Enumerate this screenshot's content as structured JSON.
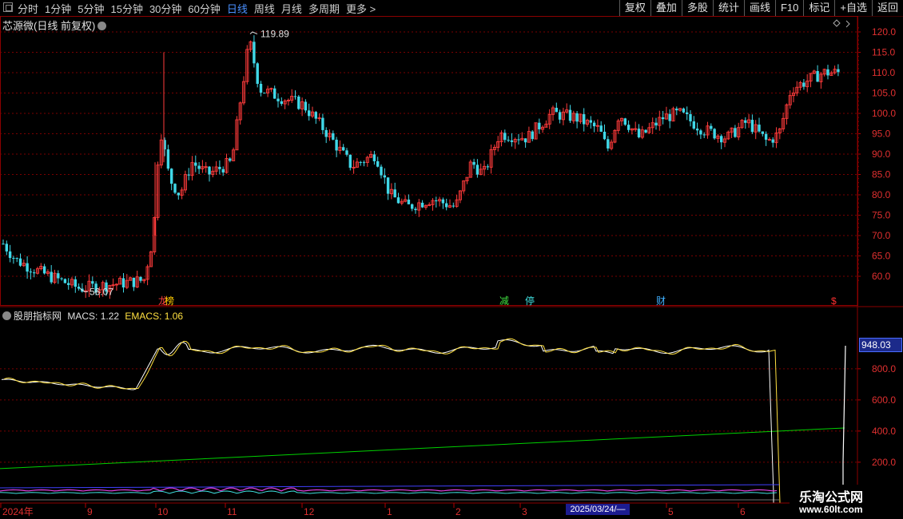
{
  "toolbar": {
    "periods": [
      "分时",
      "1分钟",
      "5分钟",
      "15分钟",
      "30分钟",
      "60分钟",
      "日线",
      "周线",
      "月线",
      "多周期",
      "更多 >"
    ],
    "active_period": "日线",
    "right_buttons": [
      "复权",
      "叠加",
      "多股",
      "统计",
      "画线",
      "F10",
      "标记",
      "+自选",
      "返回"
    ]
  },
  "main_chart": {
    "title": "芯源微(日线 前复权)",
    "price_axis": [
      "120.0",
      "115.0",
      "110.0",
      "105.0",
      "100.0",
      "95.0",
      "90.0",
      "85.0",
      "80.0",
      "75.0",
      "70.0",
      "65.0",
      "60.0"
    ],
    "high_annotation": "119.89",
    "low_annotation": "56.07",
    "event_markers": [
      {
        "text": "龙",
        "color": "#ff4040"
      },
      {
        "text": "榜",
        "color": "#ffcc00"
      },
      {
        "text": "减",
        "color": "#40e040"
      },
      {
        "text": "停",
        "color": "#40e0e0"
      },
      {
        "text": "财",
        "color": "#40b0ff"
      },
      {
        "text": "$",
        "color": "#ff3030"
      }
    ]
  },
  "indicator": {
    "title": "股朋指标网",
    "macs_label": "MACS: 1.22",
    "emacs_label": "EMACS: 1.06",
    "axis": [
      "800.0",
      "600.0",
      "400.0",
      "200.0"
    ],
    "current_value": "948.03"
  },
  "date_axis": {
    "labels": [
      "2024年",
      "9",
      "10",
      "11",
      "12",
      "1",
      "2",
      "3",
      "5",
      "6"
    ],
    "cursor_date": "2025/03/24/—"
  },
  "watermark": {
    "title": "乐淘公式网",
    "url": "www.60lt.com"
  },
  "colors": {
    "up": "#ff3b3b",
    "down": "#40d8e8",
    "grid": "#8b0000",
    "macs": "#ffffff",
    "emacs": "#ffe040",
    "trend": "#00d000"
  },
  "chart_data": {
    "type": "candlestick",
    "ylim": [
      56,
      122
    ],
    "close_path_key_points": [
      {
        "x": "2024-08",
        "y": 68
      },
      {
        "x": "2024-09",
        "y": 57
      },
      {
        "x": "2024-10",
        "y": 98
      },
      {
        "x": "2024-10",
        "y": 82
      },
      {
        "x": "2024-11",
        "y": 118
      },
      {
        "x": "2024-12",
        "y": 102
      },
      {
        "x": "2024-12",
        "y": 86
      },
      {
        "x": "2025-01",
        "y": 78
      },
      {
        "x": "2025-02",
        "y": 90
      },
      {
        "x": "2025-03",
        "y": 100
      },
      {
        "x": "2025-04",
        "y": 97
      },
      {
        "x": "2025-05",
        "y": 96
      },
      {
        "x": "2025-06",
        "y": 93
      },
      {
        "x": "2025-06",
        "y": 110
      }
    ]
  }
}
